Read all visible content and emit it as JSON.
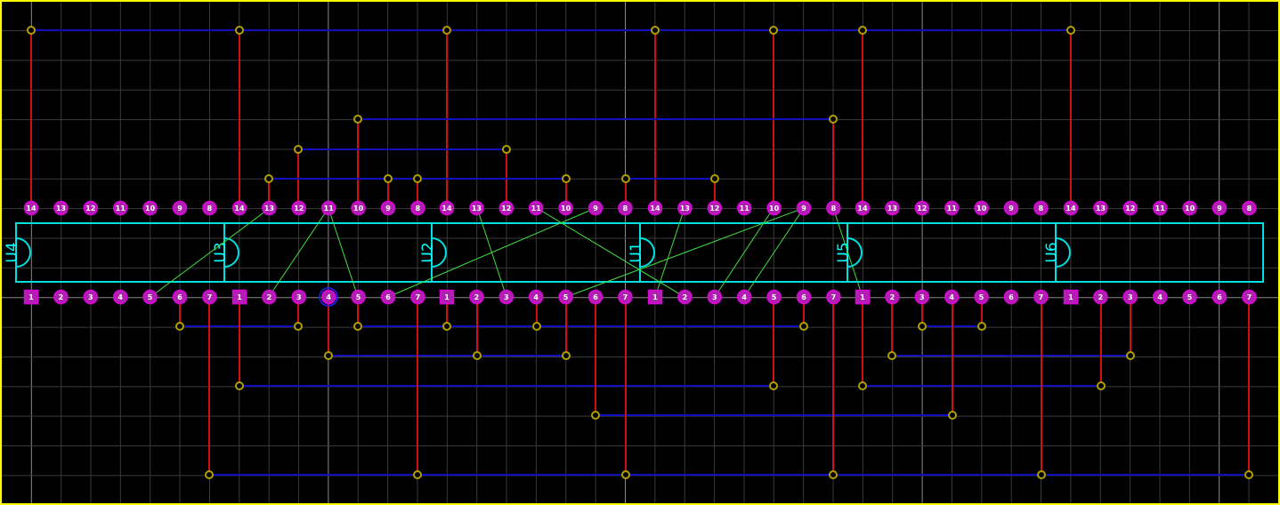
{
  "colors": {
    "background": "#000000",
    "border": "#ffff00",
    "grid_minor": "#3a3a3a",
    "grid_major": "#8a8a8a",
    "silkscreen": "#00e0e0",
    "pad_fill": "#b020b0",
    "pad_ring": "#e000e0",
    "via": "#b0a000",
    "bottom_trace": "#1010c0",
    "top_trace": "#d01010",
    "ratsnest": "#40e040",
    "pin_text": "#ffffff"
  },
  "chips": [
    {
      "ref": "U4",
      "top_pins": [
        "14",
        "13",
        "12",
        "11",
        "10",
        "9",
        "8"
      ],
      "bottom_pins": [
        "1",
        "2",
        "3",
        "4",
        "5",
        "6",
        "7"
      ]
    },
    {
      "ref": "U3",
      "top_pins": [
        "14",
        "13",
        "12",
        "11",
        "10",
        "9",
        "8"
      ],
      "bottom_pins": [
        "1",
        "2",
        "3",
        "4",
        "5",
        "6",
        "7"
      ]
    },
    {
      "ref": "U2",
      "top_pins": [
        "14",
        "13",
        "12",
        "11",
        "10",
        "9",
        "8"
      ],
      "bottom_pins": [
        "1",
        "2",
        "3",
        "4",
        "5",
        "6",
        "7"
      ]
    },
    {
      "ref": "U1",
      "top_pins": [
        "14",
        "13",
        "12",
        "11",
        "10",
        "9",
        "8"
      ],
      "bottom_pins": [
        "1",
        "2",
        "3",
        "4",
        "5",
        "6",
        "7"
      ]
    },
    {
      "ref": "U5",
      "top_pins": [
        "14",
        "13",
        "12",
        "11",
        "10",
        "9",
        "8"
      ],
      "bottom_pins": [
        "1",
        "2",
        "3",
        "4",
        "5",
        "6",
        "7"
      ]
    },
    {
      "ref": "U6",
      "top_pins": [
        "14",
        "13",
        "12",
        "11",
        "10",
        "9",
        "8"
      ],
      "bottom_pins": [
        "1",
        "2",
        "3",
        "4",
        "5",
        "6",
        "7"
      ]
    }
  ],
  "icons": {
    "pad": "round-pad-icon",
    "square_pad": "square-pad-icon",
    "via": "via-icon"
  }
}
